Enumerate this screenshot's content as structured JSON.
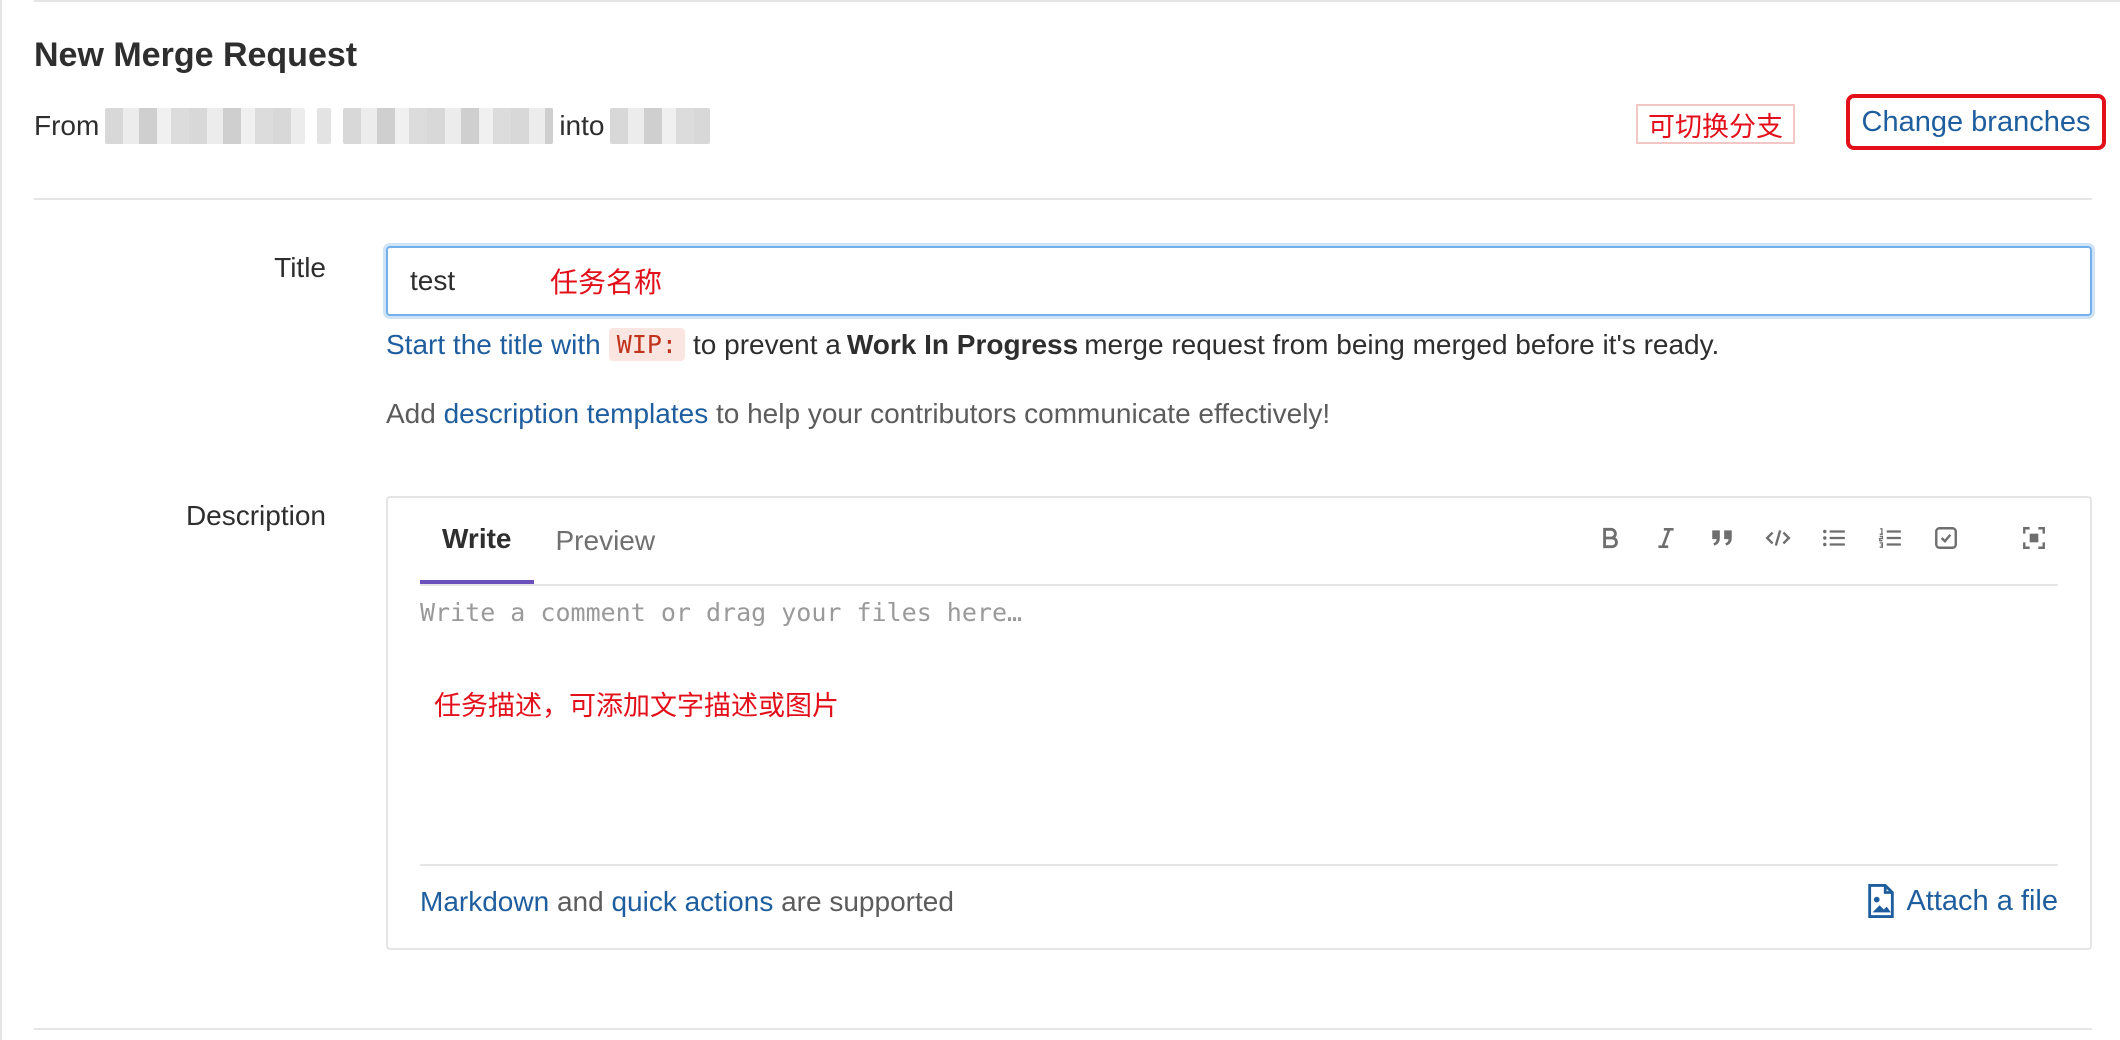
{
  "page": {
    "title": "New Merge Request",
    "from_label": "From",
    "into_label": "into",
    "branch_note": "可切换分支",
    "change_branches_label": "Change branches"
  },
  "form": {
    "title_label": "Title",
    "title_value": "test",
    "title_note": "任务名称",
    "wip_hint": {
      "link_text": "Start the title with",
      "code": "WIP:",
      "middle": "to prevent a",
      "bold": "Work In Progress",
      "end": "merge request from being merged before it's ready."
    },
    "templates_hint": {
      "prefix": "Add",
      "link_text": "description templates",
      "suffix": "to help your contributors communicate effectively!"
    },
    "description_label": "Description"
  },
  "editor": {
    "tabs": [
      {
        "label": "Write",
        "active": true
      },
      {
        "label": "Preview",
        "active": false
      }
    ],
    "toolbar": [
      "bold-icon",
      "italic-icon",
      "quote-icon",
      "code-icon",
      "bullet-list-icon",
      "numbered-list-icon",
      "task-list-icon",
      "fullscreen-icon"
    ],
    "placeholder": "Write a comment or drag your files here…",
    "description_note": "任务描述，可添加文字描述或图片",
    "footer": {
      "markdown": "Markdown",
      "and": "and",
      "quick_actions": "quick actions",
      "supported": "are supported"
    },
    "attach_label": "Attach a file"
  },
  "colors": {
    "link": "#1f5e9e",
    "annotation_red": "#e3101b",
    "active_tab_underline": "#6b4fbb",
    "focus_border": "#73afea"
  }
}
